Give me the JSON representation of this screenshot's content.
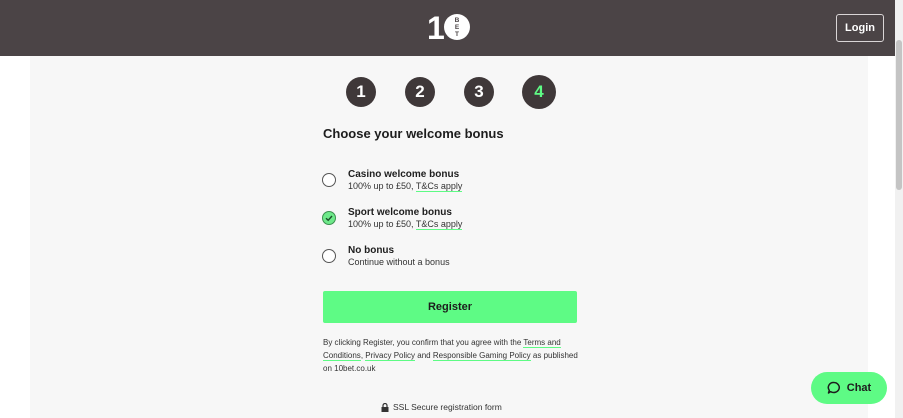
{
  "header": {
    "login_label": "Login",
    "logo_text": "10BET"
  },
  "steps": [
    "1",
    "2",
    "3",
    "4"
  ],
  "bonus": {
    "title": "Choose your welcome bonus",
    "options": [
      {
        "title": "Casino welcome bonus",
        "desc": "100% up to £50,",
        "link": "T&Cs apply",
        "selected": false
      },
      {
        "title": "Sport welcome bonus",
        "desc": "100% up to £50,",
        "link": "T&Cs apply",
        "selected": true
      },
      {
        "title": "No bonus",
        "desc": "Continue without a bonus",
        "link": "",
        "selected": false
      }
    ]
  },
  "register_label": "Register",
  "terms": {
    "prefix": "By clicking Register, you confirm that you agree with the ",
    "link1": "Terms and Conditions",
    "sep1": ", ",
    "link2": "Privacy Policy",
    "sep2": " and ",
    "link3": "Responsible Gaming Policy",
    "suffix": " as published on 10bet.co.uk"
  },
  "ssl_label": "SSL Secure registration form",
  "chat_label": "Chat",
  "colors": {
    "header_bg": "#4b4446",
    "accent": "#5efb85",
    "step_bg": "#3f3839"
  }
}
